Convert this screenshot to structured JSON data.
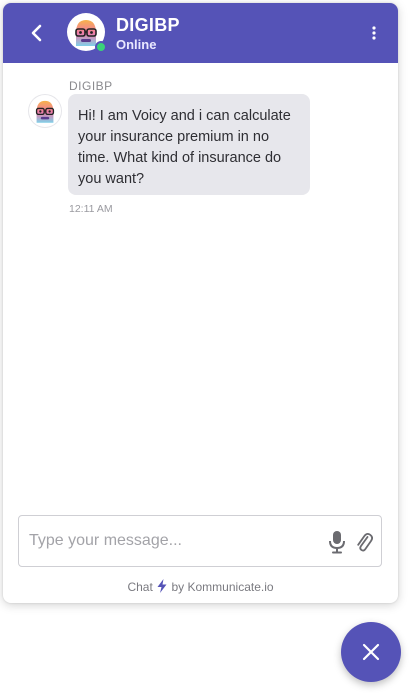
{
  "header": {
    "name": "DIGIBP",
    "status": "Online"
  },
  "conversation": {
    "messages": [
      {
        "sender": "DIGIBP",
        "text": "Hi! I am Voicy and i can calculate your insurance premium in no time. What kind of insurance do you want?",
        "time": "12:11 AM"
      }
    ]
  },
  "composer": {
    "placeholder": "Type your message...",
    "value": ""
  },
  "footer": {
    "prefix": "Chat",
    "suffix": "by Kommunicate.io"
  },
  "icons": {
    "back": "chevron-left-icon",
    "menu": "more-vertical-icon",
    "mic": "microphone-icon",
    "attach": "paperclip-icon",
    "bolt": "lightning-icon",
    "close": "close-icon"
  },
  "colors": {
    "brand": "#5553b7",
    "online": "#3ad27a",
    "bubble": "#e7e7ec"
  }
}
